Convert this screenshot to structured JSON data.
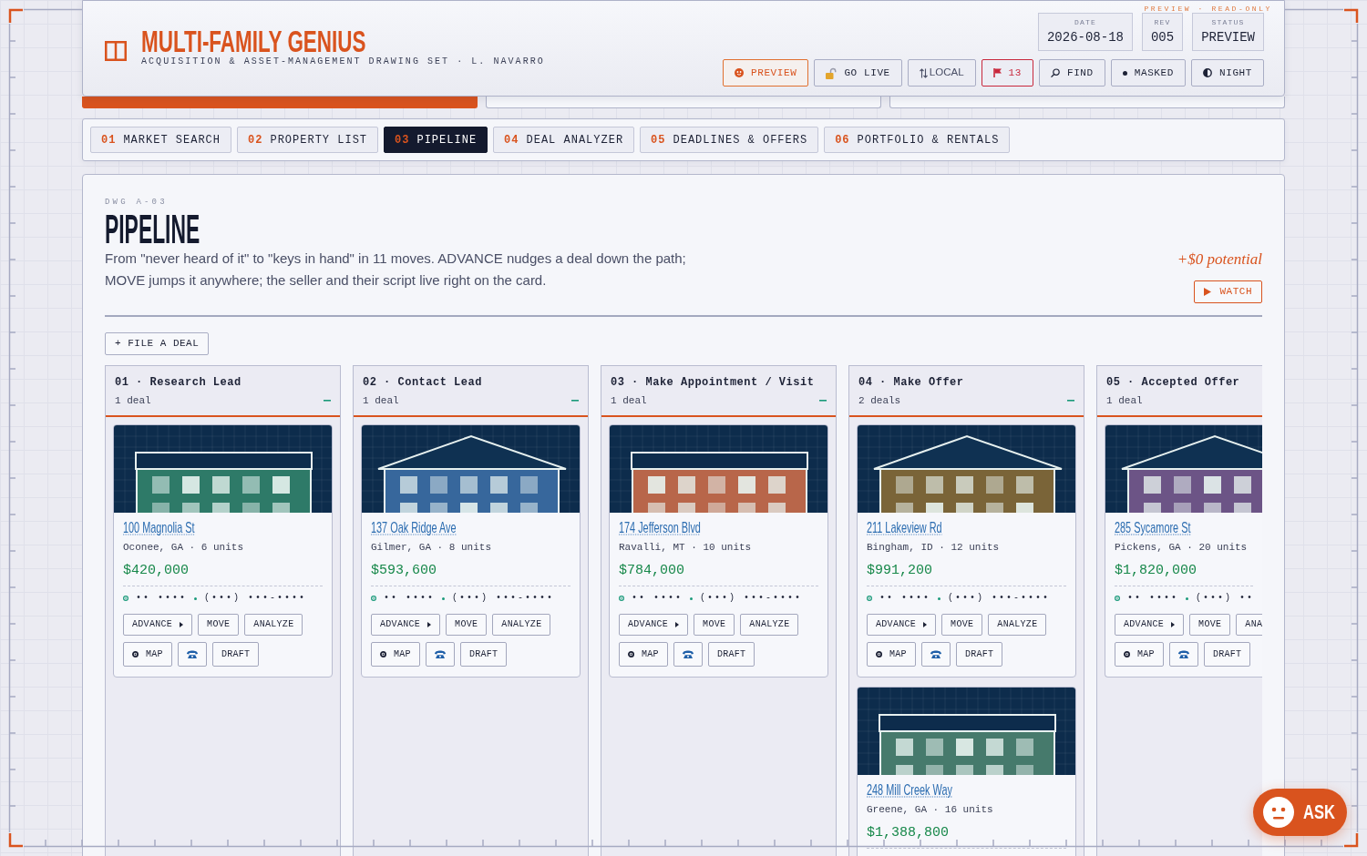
{
  "header": {
    "banner": "PREVIEW · READ-ONLY",
    "title": "MULTI-FAMILY GENIUS",
    "subtitle": "ACQUISITION & ASSET-MANAGEMENT DRAWING SET · L. NAVARRO",
    "meta": [
      {
        "label": "DATE",
        "value": "2026-08-18"
      },
      {
        "label": "REV",
        "value": "005"
      },
      {
        "label": "STATUS",
        "value": "PREVIEW"
      }
    ],
    "buttons": [
      {
        "label": "PREVIEW",
        "kind": "toggle",
        "on": true
      },
      {
        "label": "GO LIVE",
        "kind": "toggle",
        "on": false
      },
      {
        "label": "LOCAL",
        "kind": "compact",
        "on": false
      },
      {
        "label": "13",
        "kind": "alert",
        "on": false
      },
      {
        "label": "FIND",
        "kind": "toggle",
        "on": false
      },
      {
        "label": "MASKED",
        "kind": "toggle",
        "on": false
      },
      {
        "label": "NIGHT",
        "kind": "toggle",
        "on": false
      }
    ],
    "sheets": [
      {
        "selected": true
      },
      {
        "selected": false
      },
      {
        "selected": false
      }
    ]
  },
  "tabs": [
    {
      "number": "01",
      "label": "MARKET SEARCH",
      "selected": false
    },
    {
      "number": "02",
      "label": "PROPERTY LIST",
      "selected": false
    },
    {
      "number": "03",
      "label": "PIPELINE",
      "selected": true
    },
    {
      "number": "04",
      "label": "DEAL ANALYZER",
      "selected": false
    },
    {
      "number": "05",
      "label": "DEADLINES & OFFERS",
      "selected": false
    },
    {
      "number": "06",
      "label": "PORTFOLIO & RENTALS",
      "selected": false
    }
  ],
  "page": {
    "drawing_number": "DWG A-03",
    "title": "PIPELINE",
    "description": "From \"never heard of it\" to \"keys in hand\" in 11 moves. ADVANCE nudges a deal down the path; MOVE jumps it anywhere; the seller and their script live right on the card.",
    "potential": "+$0 potential",
    "watch_button": "WATCH",
    "file_button": "+ FILE A DEAL"
  },
  "columns": [
    {
      "title": "01 · Research Lead",
      "count": "1 deal",
      "collapse_toggle": true,
      "deals": [
        {
          "kind": "flat",
          "color": "#2e7a68",
          "address": "100 Magnolia St",
          "location": "Oconee, GA · 6 units",
          "price": "$420,000",
          "contact_name": "•• ••••",
          "contact_phone": "(•••) •••-••••",
          "actions": [
            "ADVANCE",
            "MOVE",
            "ANALYZE"
          ],
          "tools": [
            "MAP",
            "DRAFT"
          ]
        }
      ]
    },
    {
      "title": "02 · Contact Lead",
      "count": "1 deal",
      "collapse_toggle": true,
      "deals": [
        {
          "kind": "gable",
          "color": "#37679c",
          "address": "137 Oak Ridge Ave",
          "location": "Gilmer, GA · 8 units",
          "price": "$593,600",
          "contact_name": "•• ••••",
          "contact_phone": "(•••) •••-••••",
          "actions": [
            "ADVANCE",
            "MOVE",
            "ANALYZE"
          ],
          "tools": [
            "MAP",
            "DRAFT"
          ]
        }
      ]
    },
    {
      "title": "03 · Make Appointment / Visit",
      "count": "1 deal",
      "collapse_toggle": true,
      "deals": [
        {
          "kind": "flat",
          "color": "#b8664a",
          "address": "174 Jefferson Blvd",
          "location": "Ravalli, MT · 10 units",
          "price": "$784,000",
          "contact_name": "•• ••••",
          "contact_phone": "(•••) •••-••••",
          "actions": [
            "ADVANCE",
            "MOVE",
            "ANALYZE"
          ],
          "tools": [
            "MAP",
            "DRAFT"
          ]
        }
      ]
    },
    {
      "title": "04 · Make Offer",
      "count": "2 deals",
      "collapse_toggle": true,
      "deals": [
        {
          "kind": "gable",
          "color": "#7a6438",
          "address": "211 Lakeview Rd",
          "location": "Bingham, ID · 12 units",
          "price": "$991,200",
          "contact_name": "•• ••••",
          "contact_phone": "(•••) •••-••••",
          "actions": [
            "ADVANCE",
            "MOVE",
            "ANALYZE"
          ],
          "tools": [
            "MAP",
            "DRAFT"
          ]
        },
        {
          "kind": "flat",
          "color": "#467a6c",
          "address": "248 Mill Creek Way",
          "location": "Greene, GA · 16 units",
          "price": "$1,388,800"
        }
      ]
    },
    {
      "title": "05 · Accepted Offer",
      "count": "1 deal",
      "collapse_toggle": false,
      "deals": [
        {
          "kind": "gable",
          "color": "#6c5486",
          "address": "285 Sycamore St",
          "location": "Pickens, GA · 20 units",
          "price": "$1,820,000",
          "contact_name": "•• ••••",
          "contact_phone": "(•••) ••",
          "actions": [
            "ADVANCE",
            "MOVE",
            "ANA"
          ],
          "tools": [
            "MAP",
            "DRAFT"
          ]
        }
      ]
    }
  ],
  "assistant_button": "ASK"
}
